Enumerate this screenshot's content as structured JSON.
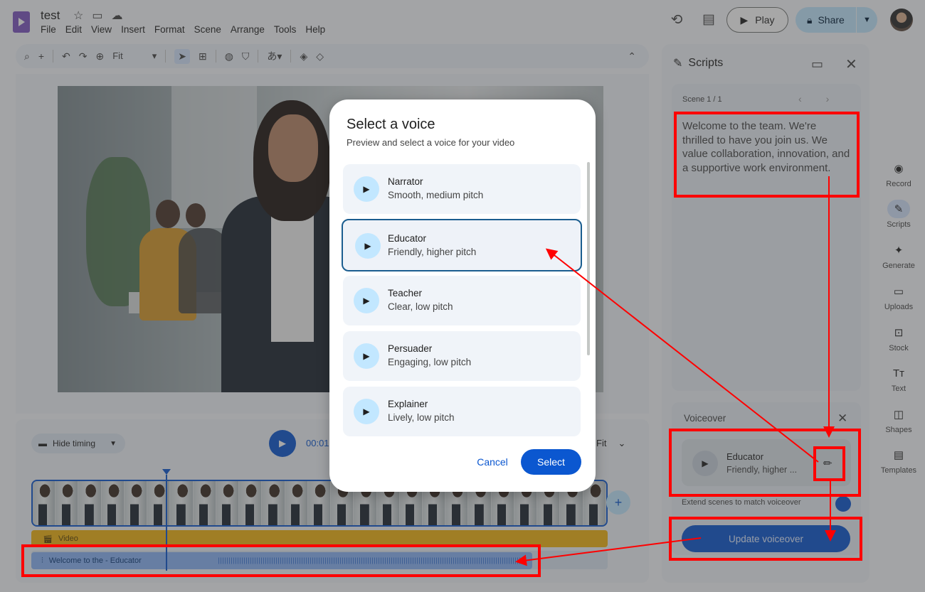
{
  "app": {
    "title": "test",
    "menu": [
      "File",
      "Edit",
      "View",
      "Insert",
      "Format",
      "Scene",
      "Arrange",
      "Tools",
      "Help"
    ]
  },
  "header": {
    "play_label": "Play",
    "share_label": "Share"
  },
  "toolbar": {
    "zoom_label": "Fit"
  },
  "timeline": {
    "hide_timing_label": "Hide timing",
    "time": "00:01",
    "zoom_label": "Fit",
    "video_track_label": "Video",
    "audio_track_label": "Welcome to the - Educator"
  },
  "scripts_panel": {
    "title": "Scripts",
    "scene_label": "Scene 1 / 1",
    "script_text": "Welcome to the team. We're thrilled to have you join us. We value collaboration, innovation, and a supportive work environment.",
    "voiceover_title": "Voiceover",
    "voice_name": "Educator",
    "voice_desc": "Friendly, higher ...",
    "extend_label": "Extend scenes to match voiceover",
    "update_label": "Update voiceover"
  },
  "rail": [
    "Record",
    "Scripts",
    "Generate",
    "Uploads",
    "Stock",
    "Text",
    "Shapes",
    "Templates"
  ],
  "dialog": {
    "title": "Select a voice",
    "subtitle": "Preview and select a voice for your video",
    "voices": [
      {
        "name": "Narrator",
        "desc": "Smooth, medium pitch"
      },
      {
        "name": "Educator",
        "desc": "Friendly, higher pitch"
      },
      {
        "name": "Teacher",
        "desc": "Clear, low pitch"
      },
      {
        "name": "Persuader",
        "desc": "Engaging, low pitch"
      },
      {
        "name": "Explainer",
        "desc": "Lively, low pitch"
      }
    ],
    "selected_index": 1,
    "cancel_label": "Cancel",
    "select_label": "Select"
  },
  "colors": {
    "accent": "#0b57d0",
    "annotation": "#ff0000"
  }
}
